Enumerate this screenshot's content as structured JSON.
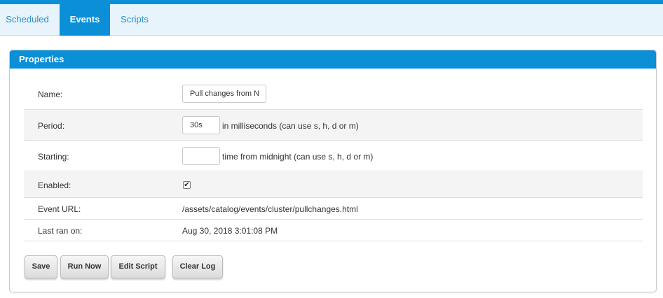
{
  "tabs": [
    {
      "label": "Scheduled",
      "active": false
    },
    {
      "label": "Events",
      "active": true
    },
    {
      "label": "Scripts",
      "active": false
    }
  ],
  "panel": {
    "title": "Properties",
    "fields": {
      "name": {
        "label": "Name:",
        "value": "Pull changes from N"
      },
      "period": {
        "label": "Period:",
        "value": "30s",
        "hint": "in milliseconds (can use s, h, d or m)"
      },
      "starting": {
        "label": "Starting:",
        "value": "",
        "hint": "time from midnight (can use s, h, d or m)"
      },
      "enabled": {
        "label": "Enabled:",
        "checked": true
      },
      "event_url": {
        "label": "Event URL:",
        "value": "/assets/catalog/events/cluster/pullchanges.html"
      },
      "last_ran": {
        "label": "Last ran on:",
        "value": "Aug 30, 2018 3:01:08 PM"
      }
    },
    "buttons": {
      "save": "Save",
      "run_now": "Run Now",
      "edit_script": "Edit Script",
      "clear_log": "Clear Log"
    }
  },
  "colors": {
    "accent": "#0b8fd6",
    "tab_bar": "#e8f4fb",
    "row_alt": "#f4f4f4"
  },
  "icons": {
    "checkbox_checked": "✔"
  }
}
